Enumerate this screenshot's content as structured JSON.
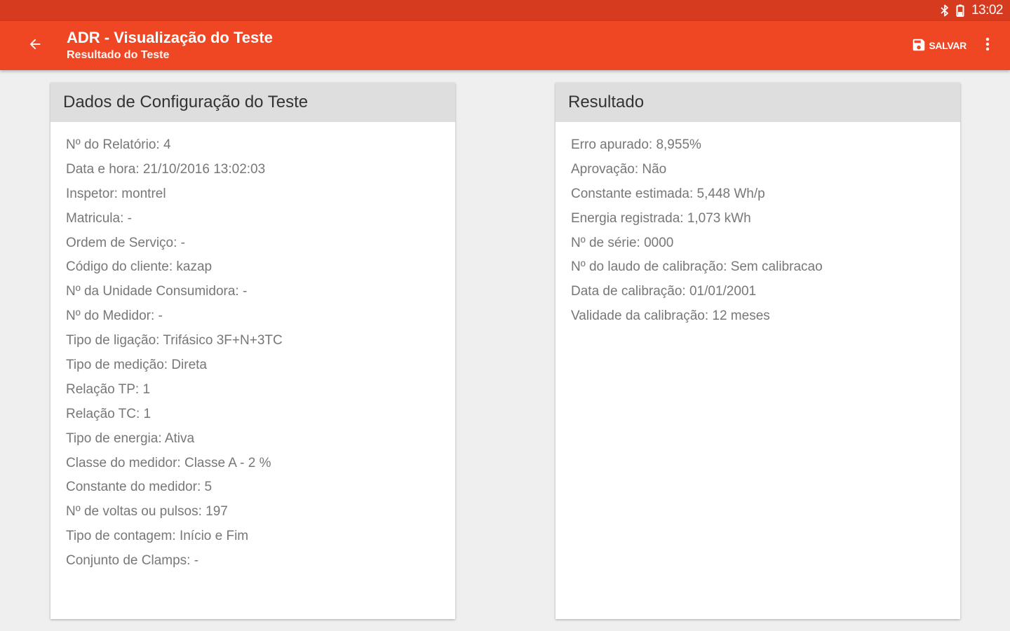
{
  "status_bar": {
    "time": "13:02",
    "icons": [
      "bluetooth-icon",
      "battery-icon"
    ]
  },
  "app_bar": {
    "title": "ADR - Visualização do Teste",
    "subtitle": "Resultado do Teste",
    "save_label": "SALVAR",
    "colors": {
      "app_bar": "#ef4723",
      "status_bar": "#d63b1f"
    }
  },
  "config_card": {
    "title": "Dados de Configuração do Teste",
    "items": [
      "Nº do Relatório: 4",
      "Data e hora: 21/10/2016 13:02:03",
      "Inspetor: montrel",
      "Matricula: -",
      "Ordem de Serviço: -",
      "Código do cliente: kazap",
      "Nº da Unidade Consumidora: -",
      "Nº do Medidor: -",
      "Tipo de ligação: Trifásico 3F+N+3TC",
      "Tipo de medição: Direta",
      "Relação TP: 1",
      "Relação TC: 1",
      "Tipo de energia: Ativa",
      "Classe do medidor: Classe A - 2 %",
      "Constante do medidor: 5",
      "Nº de voltas ou pulsos: 197",
      "Tipo de contagem: Início e Fim",
      "Conjunto de Clamps: -"
    ]
  },
  "result_card": {
    "title": "Resultado",
    "items": [
      "Erro apurado: 8,955%",
      "Aprovação: Não",
      "Constante estimada: 5,448 Wh/p",
      "Energia registrada: 1,073 kWh",
      "Nº de série: 0000",
      "Nº do laudo de calibração: Sem calibracao",
      "Data de calibração: 01/01/2001",
      "Validade da calibração: 12 meses"
    ]
  }
}
